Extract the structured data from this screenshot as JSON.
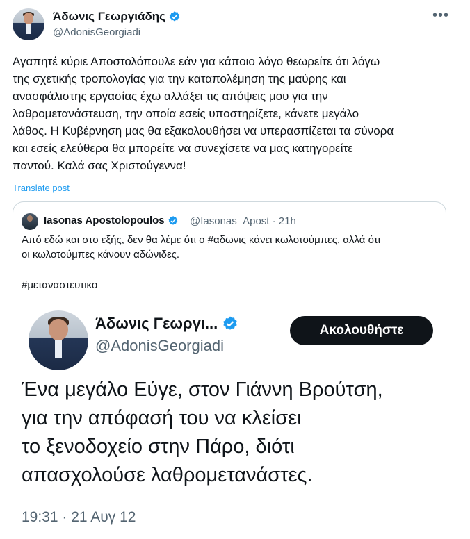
{
  "tweet": {
    "author_name": "Άδωνις Γεωργιάδης",
    "author_handle": "@AdonisGeorgiadi",
    "more_icon": "more-icon",
    "text": "Αγαπητέ κύριε Αποστολόπουλε εάν για κάποιο λόγο θεωρείτε ότι λόγω\nτης σχετικής τροπολογίας για την καταπολέμηση της μαύρης και\nανασφάλιστης εργασίας έχω αλλάξει τις απόψεις μου για την\nλαθρομετανάστευση, την οποία εσείς υποστηρίζετε, κάνετε μεγάλο\nλάθος. Η Κυβέρνηση μας θα εξακολουθήσει να υπερασπίζεται τα σύνορα\nκαι εσείς ελεύθερα θα μπορείτε να συνεχίσετε να μας κατηγορείτε\nπαντού. Καλά σας Χριστούγεννα!",
    "translate_label": "Translate post"
  },
  "quote": {
    "author_name": "Iasonas Apostolopoulos",
    "author_handle": "@Iasonas_Apost · 21h",
    "text": "Από εδώ και στο εξής, δεν θα λέμε ότι ο #αδωνις κάνει κωλοτούμπες, αλλά ότι\nοι κωλοτούμπες κάνουν αδώνιδες.",
    "hashtag": "#μεταναστευτικο"
  },
  "screenshot": {
    "author_name": "Άδωνις Γεωργι...",
    "author_handle": "@AdonisGeorgiadi",
    "follow_label": "Ακολουθήστε",
    "text": "Ένα μεγάλο Εύγε, στον Γιάννη Βρούτση,\nγια την απόφασή του να κλείσει\nτο ξενοδοχείο στην Πάρο, διότι\nαπασχολούσε λαθρομετανάστες.",
    "timestamp": "19:31 · 21 Αυγ 12"
  },
  "colors": {
    "accent": "#1d9bf0",
    "text": "#0f1419",
    "secondary": "#536471",
    "border": "#cfd9de"
  }
}
